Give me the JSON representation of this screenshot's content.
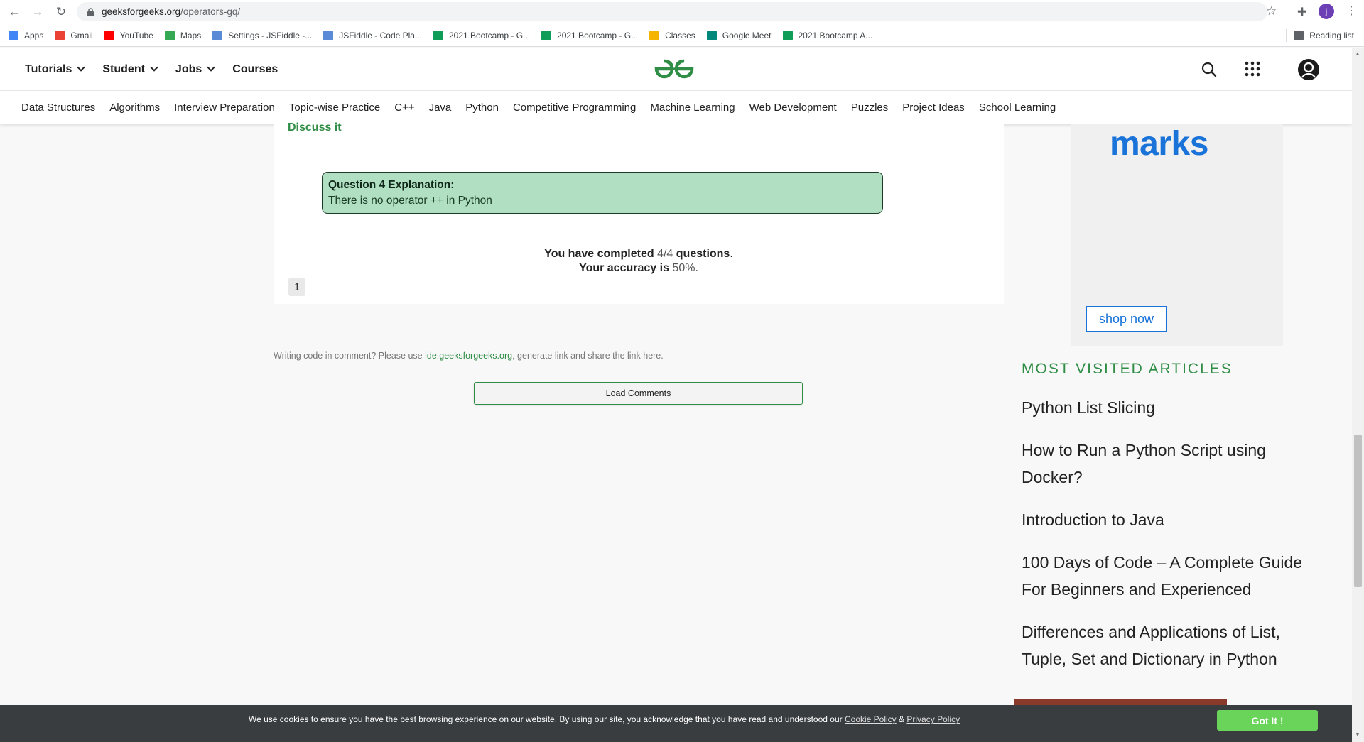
{
  "browser": {
    "url_host": "geeksforgeeks.org",
    "url_path": "/operators-gq/",
    "profile_initial": "j",
    "bookmarks": [
      {
        "label": "Apps",
        "icon": "apps-grid-icon",
        "color": "#4285f4"
      },
      {
        "label": "Gmail",
        "icon": "gmail-icon",
        "color": "#ea4335"
      },
      {
        "label": "YouTube",
        "icon": "youtube-icon",
        "color": "#ff0000"
      },
      {
        "label": "Maps",
        "icon": "maps-icon",
        "color": "#34a853"
      },
      {
        "label": "Settings - JSFiddle -...",
        "icon": "cloud-icon",
        "color": "#5b8bd6"
      },
      {
        "label": "JSFiddle - Code Pla...",
        "icon": "cloud-icon",
        "color": "#5b8bd6"
      },
      {
        "label": "2021 Bootcamp - G...",
        "icon": "sheets-icon",
        "color": "#0f9d58"
      },
      {
        "label": "2021 Bootcamp - G...",
        "icon": "sheets-icon",
        "color": "#0f9d58"
      },
      {
        "label": "Classes",
        "icon": "classroom-icon",
        "color": "#f4b400"
      },
      {
        "label": "Google Meet",
        "icon": "meet-icon",
        "color": "#00897b"
      },
      {
        "label": "2021 Bootcamp A...",
        "icon": "sheets-icon",
        "color": "#0f9d58"
      }
    ],
    "reading_list": "Reading list"
  },
  "header": {
    "top_nav": [
      "Tutorials",
      "Student",
      "Jobs",
      "Courses"
    ],
    "sub_nav": [
      "Data Structures",
      "Algorithms",
      "Interview Preparation",
      "Topic-wise Practice",
      "C++",
      "Java",
      "Python",
      "Competitive Programming",
      "Machine Learning",
      "Web Development",
      "Puzzles",
      "Project Ideas",
      "School Learning"
    ],
    "brand_color": "#2f8d46"
  },
  "quiz": {
    "discuss": "Discuss it",
    "explanation_title": "Question 4 Explanation:",
    "explanation_body": "There is no operator ++ in Python",
    "completed_prefix": "You have completed",
    "completed_value": "4/4",
    "completed_suffix": "questions",
    "accuracy_prefix": "Your accuracy is",
    "accuracy_value": "50%",
    "page": "1"
  },
  "comments": {
    "note_prefix": "Writing code in comment? Please use",
    "note_link": "ide.geeksforgeeks.org",
    "note_suffix": ", generate link and share the link here.",
    "load_button": "Load Comments"
  },
  "ad": {
    "headline": "marks",
    "cta": "shop now"
  },
  "most_visited": {
    "title": "MOST VISITED ARTICLES",
    "articles": [
      "Python List Slicing",
      "How to Run a Python Script using Docker?",
      "Introduction to Java",
      "100 Days of Code – A Complete Guide For Beginners and Experienced",
      "Differences and Applications of List, Tuple, Set and Dictionary in Python"
    ]
  },
  "cookie": {
    "text": "We use cookies to ensure you have the best browsing experience on our website. By using our site, you acknowledge that you have read and understood our",
    "cookie_policy": "Cookie Policy",
    "amp": "&",
    "privacy_policy": "Privacy Policy",
    "button": "Got It !"
  }
}
